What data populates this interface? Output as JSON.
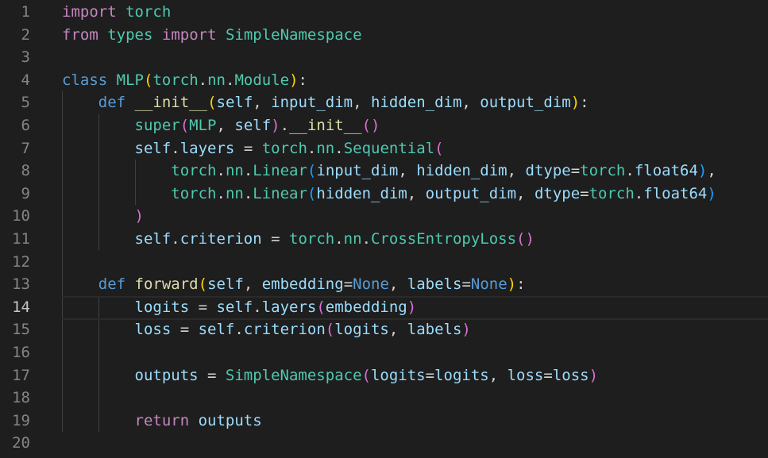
{
  "editor": {
    "current_line": 14,
    "lines": [
      {
        "n": "1",
        "tokens": [
          [
            "import",
            "kw"
          ],
          [
            " ",
            "op"
          ],
          [
            "torch",
            "cls"
          ]
        ]
      },
      {
        "n": "2",
        "tokens": [
          [
            "from",
            "kw"
          ],
          [
            " ",
            "op"
          ],
          [
            "types",
            "cls"
          ],
          [
            " ",
            "op"
          ],
          [
            "import",
            "kw"
          ],
          [
            " ",
            "op"
          ],
          [
            "SimpleNamespace",
            "cls"
          ]
        ]
      },
      {
        "n": "3",
        "tokens": []
      },
      {
        "n": "4",
        "tokens": [
          [
            "class",
            "dec"
          ],
          [
            " ",
            "op"
          ],
          [
            "MLP",
            "cls"
          ],
          [
            "(",
            "p1"
          ],
          [
            "torch",
            "cls"
          ],
          [
            ".",
            "op"
          ],
          [
            "nn",
            "cls"
          ],
          [
            ".",
            "op"
          ],
          [
            "Module",
            "cls"
          ],
          [
            ")",
            "p1"
          ],
          [
            ":",
            "op"
          ]
        ]
      },
      {
        "n": "5",
        "tokens": [
          [
            "    ",
            "op"
          ],
          [
            "def",
            "dec"
          ],
          [
            " ",
            "op"
          ],
          [
            "__init__",
            "fn"
          ],
          [
            "(",
            "p1"
          ],
          [
            "self",
            "var"
          ],
          [
            ", ",
            "op"
          ],
          [
            "input_dim",
            "var"
          ],
          [
            ", ",
            "op"
          ],
          [
            "hidden_dim",
            "var"
          ],
          [
            ", ",
            "op"
          ],
          [
            "output_dim",
            "var"
          ],
          [
            ")",
            "p1"
          ],
          [
            ":",
            "op"
          ]
        ]
      },
      {
        "n": "6",
        "tokens": [
          [
            "        ",
            "op"
          ],
          [
            "super",
            "cls"
          ],
          [
            "(",
            "p2"
          ],
          [
            "MLP",
            "cls"
          ],
          [
            ", ",
            "op"
          ],
          [
            "self",
            "var"
          ],
          [
            ")",
            "p2"
          ],
          [
            ".",
            "op"
          ],
          [
            "__init__",
            "fn"
          ],
          [
            "()",
            "p2"
          ]
        ]
      },
      {
        "n": "7",
        "tokens": [
          [
            "        ",
            "op"
          ],
          [
            "self",
            "var"
          ],
          [
            ".",
            "op"
          ],
          [
            "layers",
            "var"
          ],
          [
            " = ",
            "op"
          ],
          [
            "torch",
            "cls"
          ],
          [
            ".",
            "op"
          ],
          [
            "nn",
            "cls"
          ],
          [
            ".",
            "op"
          ],
          [
            "Sequential",
            "cls"
          ],
          [
            "(",
            "p2"
          ]
        ]
      },
      {
        "n": "8",
        "tokens": [
          [
            "            ",
            "op"
          ],
          [
            "torch",
            "cls"
          ],
          [
            ".",
            "op"
          ],
          [
            "nn",
            "cls"
          ],
          [
            ".",
            "op"
          ],
          [
            "Linear",
            "cls"
          ],
          [
            "(",
            "p3"
          ],
          [
            "input_dim",
            "var"
          ],
          [
            ", ",
            "op"
          ],
          [
            "hidden_dim",
            "var"
          ],
          [
            ", ",
            "op"
          ],
          [
            "dtype",
            "var"
          ],
          [
            "=",
            "op"
          ],
          [
            "torch",
            "cls"
          ],
          [
            ".",
            "op"
          ],
          [
            "float64",
            "var"
          ],
          [
            ")",
            "p3"
          ],
          [
            ",",
            "op"
          ]
        ]
      },
      {
        "n": "9",
        "tokens": [
          [
            "            ",
            "op"
          ],
          [
            "torch",
            "cls"
          ],
          [
            ".",
            "op"
          ],
          [
            "nn",
            "cls"
          ],
          [
            ".",
            "op"
          ],
          [
            "Linear",
            "cls"
          ],
          [
            "(",
            "p3"
          ],
          [
            "hidden_dim",
            "var"
          ],
          [
            ", ",
            "op"
          ],
          [
            "output_dim",
            "var"
          ],
          [
            ", ",
            "op"
          ],
          [
            "dtype",
            "var"
          ],
          [
            "=",
            "op"
          ],
          [
            "torch",
            "cls"
          ],
          [
            ".",
            "op"
          ],
          [
            "float64",
            "var"
          ],
          [
            ")",
            "p3"
          ]
        ]
      },
      {
        "n": "10",
        "tokens": [
          [
            "        ",
            "op"
          ],
          [
            ")",
            "p2"
          ]
        ]
      },
      {
        "n": "11",
        "tokens": [
          [
            "        ",
            "op"
          ],
          [
            "self",
            "var"
          ],
          [
            ".",
            "op"
          ],
          [
            "criterion",
            "var"
          ],
          [
            " = ",
            "op"
          ],
          [
            "torch",
            "cls"
          ],
          [
            ".",
            "op"
          ],
          [
            "nn",
            "cls"
          ],
          [
            ".",
            "op"
          ],
          [
            "CrossEntropyLoss",
            "cls"
          ],
          [
            "()",
            "p2"
          ]
        ]
      },
      {
        "n": "12",
        "tokens": []
      },
      {
        "n": "13",
        "tokens": [
          [
            "    ",
            "op"
          ],
          [
            "def",
            "dec"
          ],
          [
            " ",
            "op"
          ],
          [
            "forward",
            "fn"
          ],
          [
            "(",
            "p1"
          ],
          [
            "self",
            "var"
          ],
          [
            ", ",
            "op"
          ],
          [
            "embedding",
            "var"
          ],
          [
            "=",
            "op"
          ],
          [
            "None",
            "dec"
          ],
          [
            ", ",
            "op"
          ],
          [
            "labels",
            "var"
          ],
          [
            "=",
            "op"
          ],
          [
            "None",
            "dec"
          ],
          [
            ")",
            "p1"
          ],
          [
            ":",
            "op"
          ]
        ]
      },
      {
        "n": "14",
        "tokens": [
          [
            "        ",
            "op"
          ],
          [
            "logits",
            "var"
          ],
          [
            " = ",
            "op"
          ],
          [
            "self",
            "var"
          ],
          [
            ".",
            "op"
          ],
          [
            "layers",
            "var"
          ],
          [
            "(",
            "p2"
          ],
          [
            "embedding",
            "var"
          ],
          [
            ")",
            "p2"
          ]
        ]
      },
      {
        "n": "15",
        "tokens": [
          [
            "        ",
            "op"
          ],
          [
            "loss",
            "var"
          ],
          [
            " = ",
            "op"
          ],
          [
            "self",
            "var"
          ],
          [
            ".",
            "op"
          ],
          [
            "criterion",
            "var"
          ],
          [
            "(",
            "p2"
          ],
          [
            "logits",
            "var"
          ],
          [
            ", ",
            "op"
          ],
          [
            "labels",
            "var"
          ],
          [
            ")",
            "p2"
          ]
        ]
      },
      {
        "n": "16",
        "tokens": []
      },
      {
        "n": "17",
        "tokens": [
          [
            "        ",
            "op"
          ],
          [
            "outputs",
            "var"
          ],
          [
            " = ",
            "op"
          ],
          [
            "SimpleNamespace",
            "cls"
          ],
          [
            "(",
            "p2"
          ],
          [
            "logits",
            "var"
          ],
          [
            "=",
            "op"
          ],
          [
            "logits",
            "var"
          ],
          [
            ", ",
            "op"
          ],
          [
            "loss",
            "var"
          ],
          [
            "=",
            "op"
          ],
          [
            "loss",
            "var"
          ],
          [
            ")",
            "p2"
          ]
        ]
      },
      {
        "n": "18",
        "tokens": []
      },
      {
        "n": "19",
        "tokens": [
          [
            "        ",
            "op"
          ],
          [
            "return",
            "kw"
          ],
          [
            " ",
            "op"
          ],
          [
            "outputs",
            "var"
          ]
        ]
      },
      {
        "n": "20",
        "tokens": []
      }
    ]
  }
}
